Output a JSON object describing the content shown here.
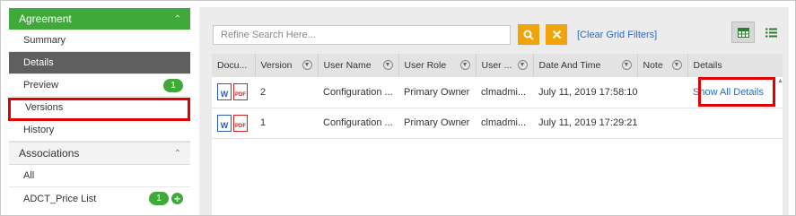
{
  "sidebar": {
    "agreement_header": "Agreement",
    "items": [
      {
        "label": "Summary",
        "active": false
      },
      {
        "label": "Details",
        "active": true
      },
      {
        "label": "Preview",
        "badge": "1"
      },
      {
        "label": "Versions"
      },
      {
        "label": "History"
      }
    ],
    "associations_header": "Associations",
    "assoc_items": [
      {
        "label": "All"
      },
      {
        "label": "ADCT_Price List",
        "badge": "1"
      }
    ]
  },
  "toolbar": {
    "search_placeholder": "Refine Search Here...",
    "clear_filters": "[Clear Grid Filters]"
  },
  "grid": {
    "columns": [
      "Docu...",
      "Version",
      "User Name",
      "User Role",
      "User ...",
      "Date And Time",
      "Note",
      "Details"
    ],
    "rows": [
      {
        "version": "2",
        "user_name": "Configuration ...",
        "user_role": "Primary Owner",
        "user": "clmadmi...",
        "date_time": "July 11, 2019 17:58:10",
        "note": "",
        "details": "Show All Details"
      },
      {
        "version": "1",
        "user_name": "Configuration ...",
        "user_role": "Primary Owner",
        "user": "clmadmi...",
        "date_time": "July 11, 2019 17:29:21",
        "note": "",
        "details": ""
      }
    ]
  },
  "colors": {
    "accent_green": "#3faa3a",
    "button_orange": "#f0a30a",
    "highlight_red": "#e00000",
    "link_blue": "#2b6cc4"
  }
}
